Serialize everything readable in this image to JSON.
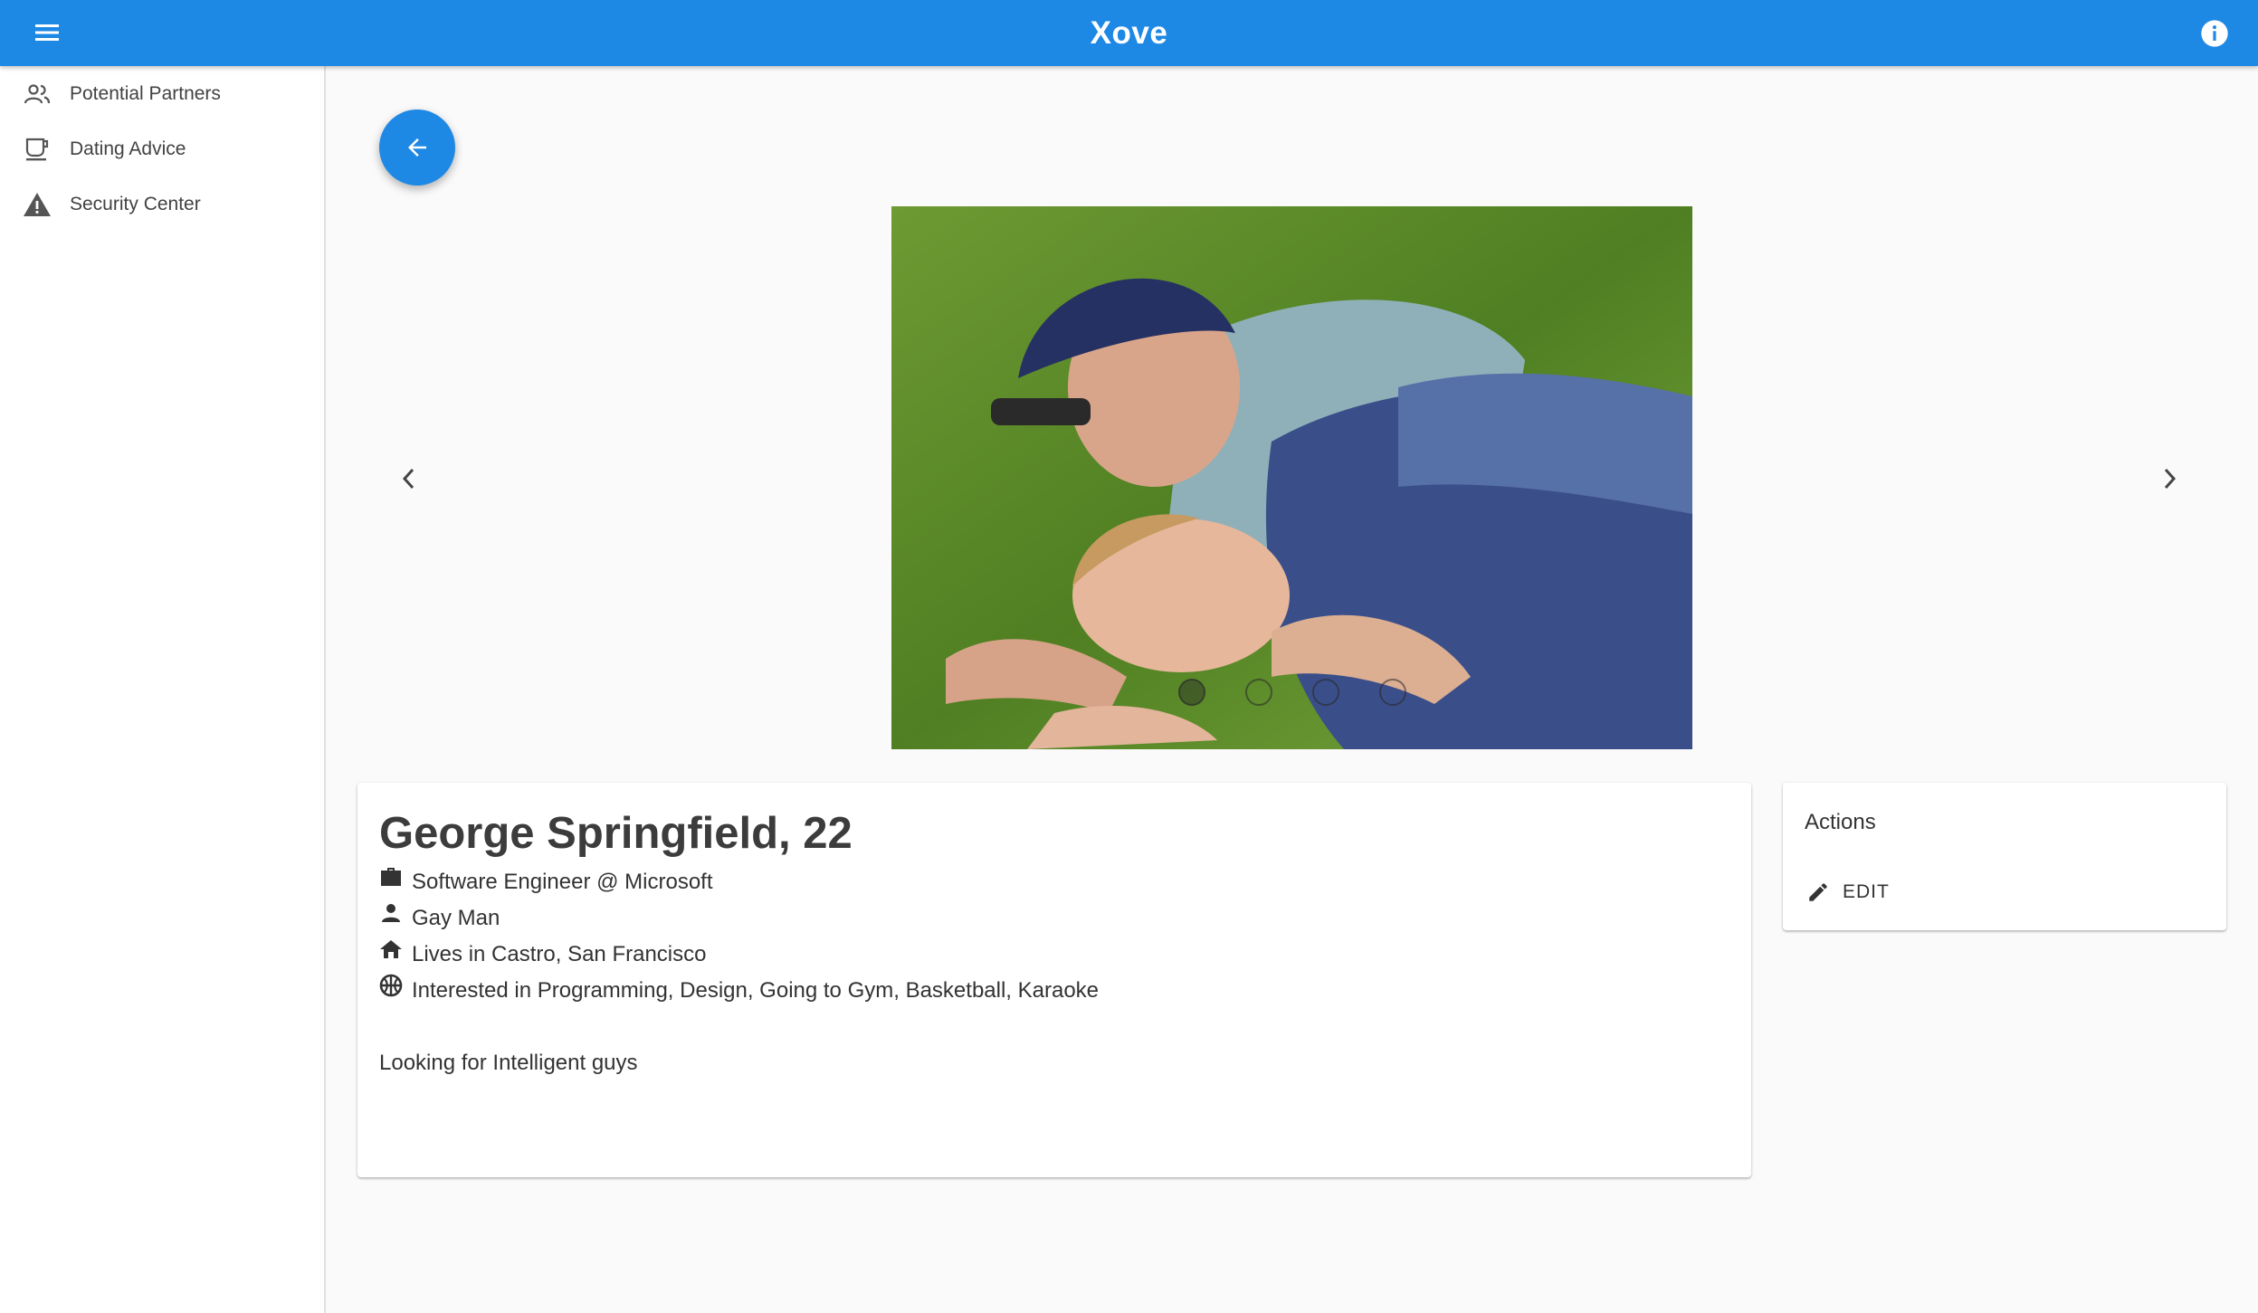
{
  "app": {
    "title": "Xove"
  },
  "appbar": {
    "menu_icon": "menu-icon",
    "info_icon": "info-icon"
  },
  "sidebar": {
    "items": [
      {
        "label": "Potential Partners",
        "icon": "people-icon"
      },
      {
        "label": "Dating Advice",
        "icon": "coffee-cup-icon"
      },
      {
        "label": "Security Center",
        "icon": "warning-icon"
      }
    ]
  },
  "carousel": {
    "photo_alt": "Two men lying on grass",
    "dots_count": 4,
    "active_dot": 0
  },
  "profile": {
    "name": "George Springfield, 22",
    "occupation": "Software Engineer @ Microsoft",
    "identity": "Gay Man",
    "location": "Lives in Castro, San Francisco",
    "interests": "Interested in Programming, Design, Going to Gym, Basketball, Karaoke",
    "bio": "Looking for Intelligent guys"
  },
  "actions": {
    "title": "Actions",
    "edit_label": "EDIT"
  },
  "colors": {
    "primary": "#1e88e5",
    "background": "#fafafa",
    "card": "#ffffff"
  }
}
